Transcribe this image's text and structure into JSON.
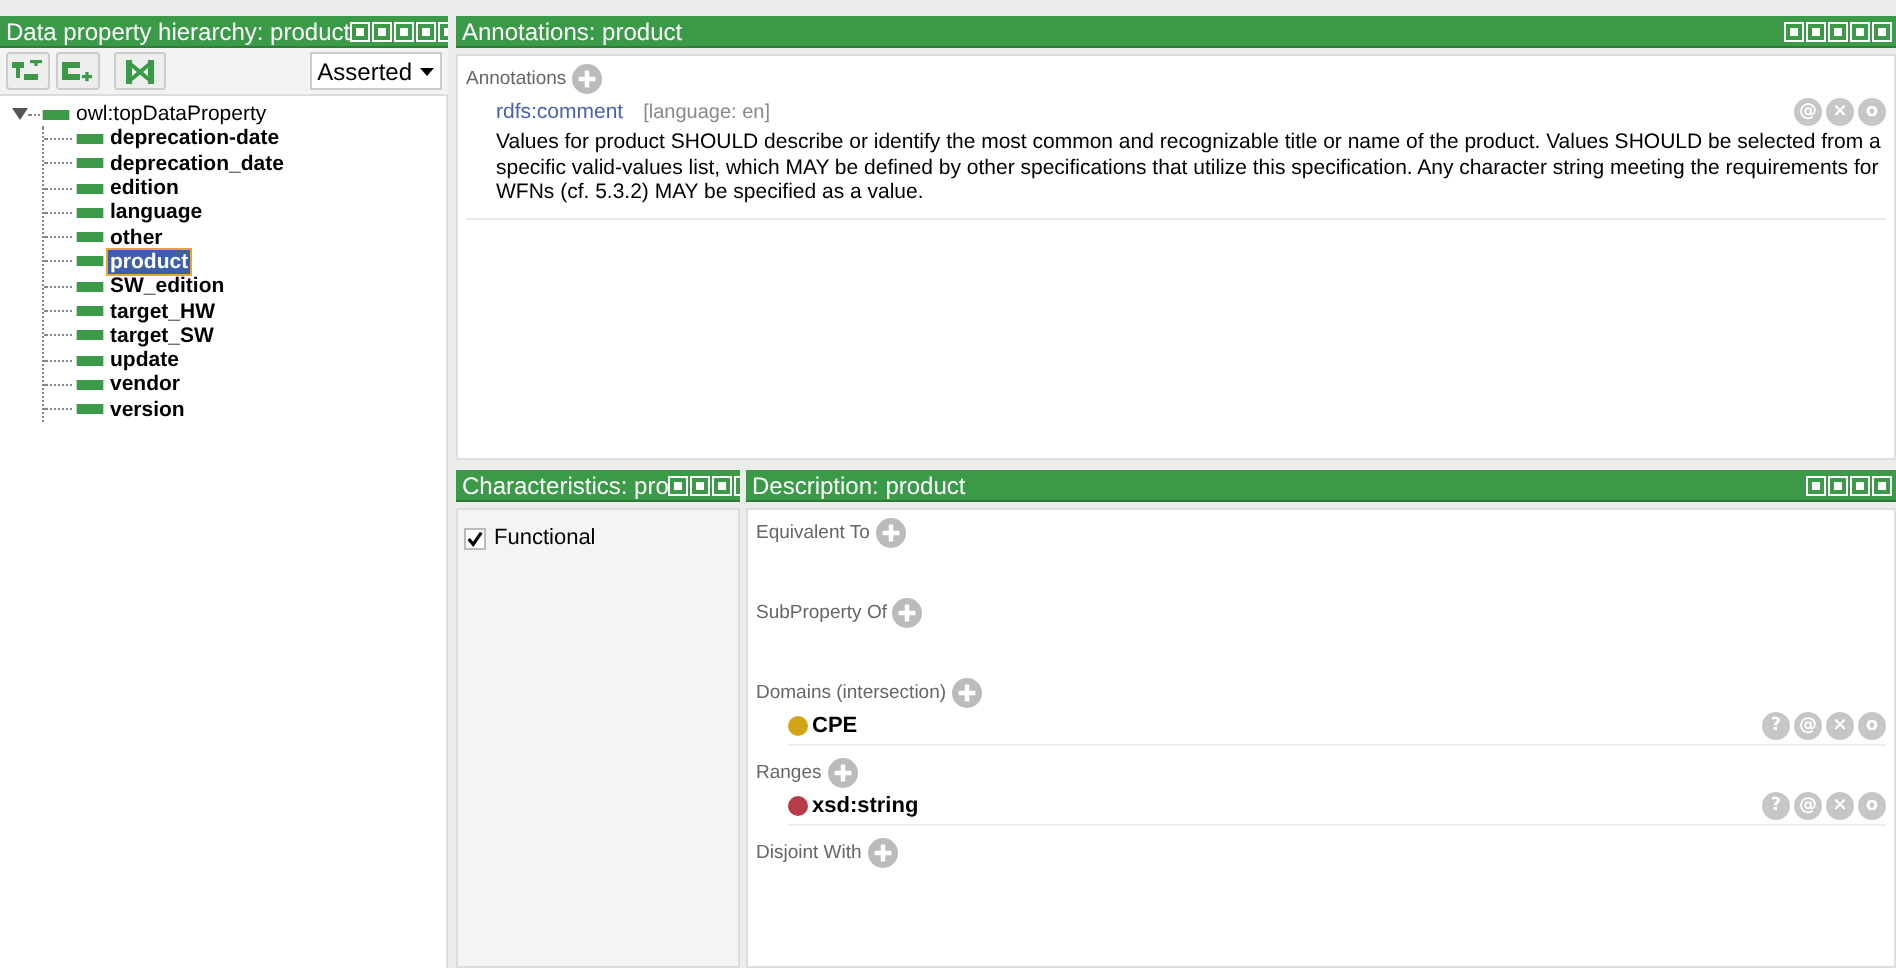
{
  "hierarchy": {
    "title": "Data property hierarchy: product",
    "mode": "Asserted",
    "tree": [
      {
        "label": "owl:topDataProperty",
        "expanded": true,
        "selected": false,
        "children": [
          {
            "label": "deprecation-date",
            "selected": false
          },
          {
            "label": "deprecation_date",
            "selected": false
          },
          {
            "label": "edition",
            "selected": false
          },
          {
            "label": "language",
            "selected": false
          },
          {
            "label": "other",
            "selected": false
          },
          {
            "label": "product",
            "selected": true
          },
          {
            "label": "SW_edition",
            "selected": false
          },
          {
            "label": "target_HW",
            "selected": false
          },
          {
            "label": "target_SW",
            "selected": false
          },
          {
            "label": "update",
            "selected": false
          },
          {
            "label": "vendor",
            "selected": false
          },
          {
            "label": "version",
            "selected": false
          }
        ]
      }
    ]
  },
  "annotations": {
    "title": "Annotations: product",
    "section": "Annotations",
    "items": [
      {
        "property": "rdfs:comment",
        "language": "[language: en]",
        "text": "Values for product SHOULD describe or identify the most common and recognizable title or name of the product. Values SHOULD be selected from a specific valid-values list, which MAY be defined by other specifications that utilize this specification. Any character string meeting the requirements for WFNs (cf. 5.3.2) MAY be specified as a value.",
        "buttons": [
          "@",
          "×",
          "o"
        ]
      }
    ]
  },
  "characteristics": {
    "title": "Characteristics: pro",
    "items": [
      {
        "label": "Functional",
        "checked": true
      }
    ]
  },
  "description": {
    "title": "Description: product",
    "sections": [
      {
        "label": "Equivalent To"
      },
      {
        "label": "SubProperty Of"
      },
      {
        "label": "Domains (intersection)",
        "items": [
          {
            "label": "CPE",
            "color": "#d4a417",
            "buttons": [
              "?",
              "@",
              "×",
              "o"
            ]
          }
        ]
      },
      {
        "label": "Ranges",
        "items": [
          {
            "label": "xsd:string",
            "color": "#b83c48",
            "buttons": [
              "?",
              "@",
              "×",
              "o"
            ]
          }
        ]
      },
      {
        "label": "Disjoint With"
      }
    ]
  }
}
